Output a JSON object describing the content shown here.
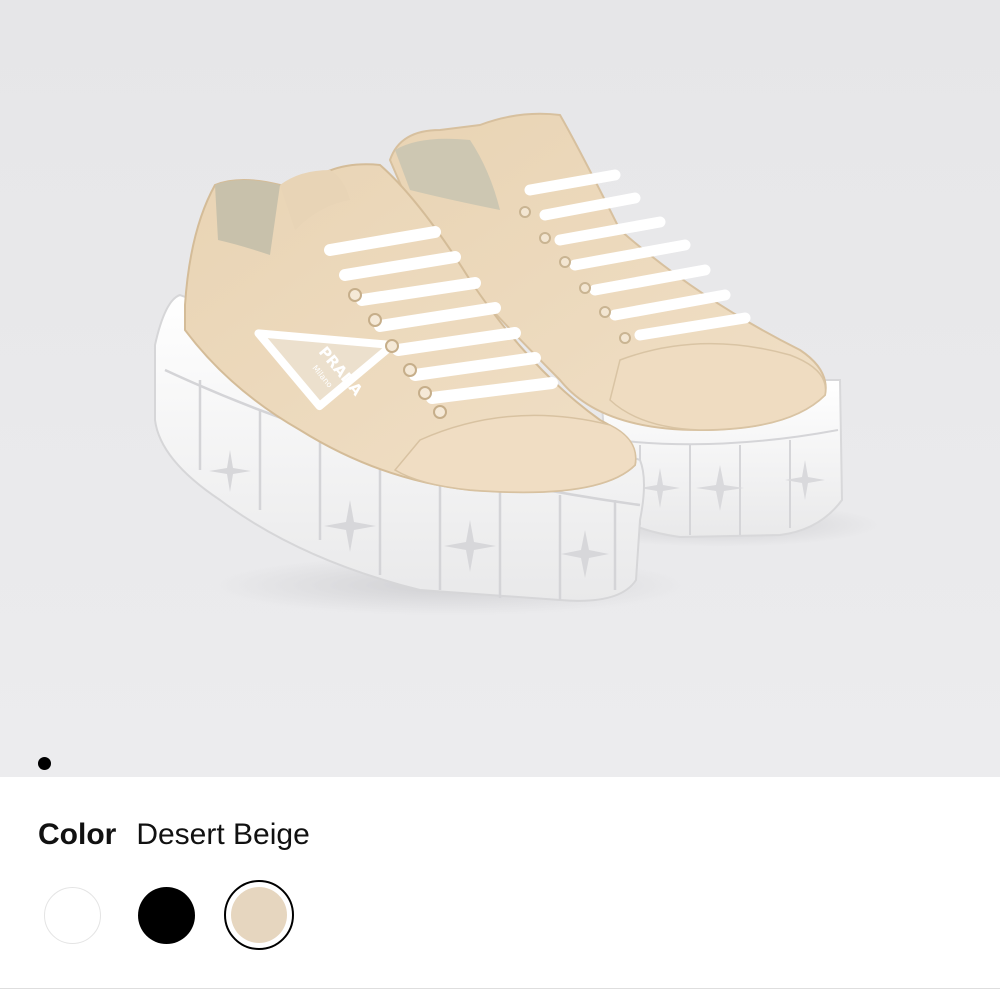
{
  "gallery": {
    "image": "desert-beige-platform-sneakers",
    "logo_text": "PRADA",
    "logo_subtext": "Milano",
    "current_slide": 1,
    "total_slides": 1
  },
  "color_selector": {
    "label": "Color",
    "selected_value": "Desert Beige",
    "swatches": [
      {
        "name": "white",
        "hex": "#ffffff",
        "selected": false
      },
      {
        "name": "black",
        "hex": "#000000",
        "selected": false
      },
      {
        "name": "desert-beige",
        "hex": "#e6d6bf",
        "selected": true
      }
    ]
  },
  "colors": {
    "gallery_background": "#e9e9eb",
    "upper": "#ecd9bd",
    "sole": "#f7f7f7"
  }
}
